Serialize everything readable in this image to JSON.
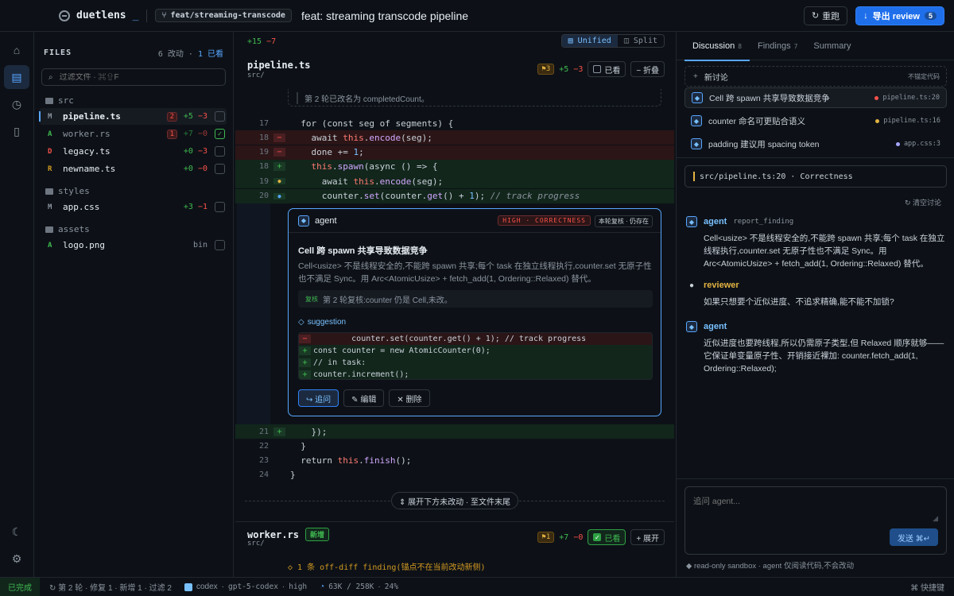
{
  "app": {
    "name": "duetlens",
    "cursor": "_"
  },
  "branch": "feat/streaming-transcode",
  "pr_title": "feat: streaming transcode pipeline",
  "actions": {
    "rerun": "重跑",
    "export": "导出 review",
    "export_count": "5"
  },
  "files": {
    "title": "FILES",
    "changes": "6 改动",
    "sep": "·",
    "seen": "1 已看",
    "filter_placeholder": "过滤文件 · ⌘⇧F",
    "groups": [
      {
        "folder": "src",
        "items": [
          {
            "status": "M",
            "name": "pipeline.ts",
            "badge": "2",
            "add": "+5",
            "del": "−3",
            "checked": false
          },
          {
            "status": "A",
            "name": "worker.rs",
            "badge": "1",
            "add": "+7",
            "del": "−0",
            "checked": true
          },
          {
            "status": "D",
            "name": "legacy.ts",
            "add": "+0",
            "del": "−3",
            "checked": false
          },
          {
            "status": "R",
            "name": "newname.ts",
            "add": "+0",
            "del": "−0",
            "checked": false
          }
        ]
      },
      {
        "folder": "styles",
        "items": [
          {
            "status": "M",
            "name": "app.css",
            "add": "+3",
            "del": "−1",
            "checked": false
          }
        ]
      },
      {
        "folder": "assets",
        "items": [
          {
            "status": "A",
            "name": "logo.png",
            "bin": "bin",
            "checked": false
          }
        ]
      }
    ]
  },
  "diff": {
    "summary_add": "+15",
    "summary_del": "−7",
    "view_unified": "Unified",
    "view_split": "Split",
    "file1": {
      "name": "pipeline.ts",
      "dir": "src/",
      "flags": "⚑3",
      "add": "+5",
      "del": "−3",
      "seen_label": "已看",
      "collapse_label": "− 折叠"
    },
    "prev_note": "第 2 轮已改名为 completedCount。",
    "lines_top": [
      {
        "ln": "17",
        "mk": "",
        "type": "ctx",
        "code": "  for (const seg of segments) {"
      },
      {
        "ln": "18",
        "mk": "−",
        "type": "del",
        "code": "    await this.encode(seg);"
      },
      {
        "ln": "19",
        "mk": "−",
        "type": "del",
        "code": "    done += 1;"
      },
      {
        "ln": "18",
        "mk": "+",
        "type": "add",
        "code": "    this.spawn(async () => {"
      },
      {
        "ln": "19",
        "mk": "●",
        "type": "add",
        "code": "      await this.encode(seg);"
      },
      {
        "ln": "20",
        "mk": "●",
        "type": "add",
        "code": "      counter.set(counter.get() + 1); // track progress"
      }
    ],
    "lines_bottom": [
      {
        "ln": "21",
        "mk": "+",
        "type": "add",
        "code": "    });"
      },
      {
        "ln": "22",
        "mk": "",
        "type": "ctx",
        "code": "  }"
      },
      {
        "ln": "23",
        "mk": "",
        "type": "ctx",
        "code": "  return this.finish();"
      },
      {
        "ln": "24",
        "mk": "",
        "type": "ctx",
        "code": "}"
      }
    ],
    "card": {
      "author": "agent",
      "severity": "HIGH · CORRECTNESS",
      "recheck": "本轮复核 · 仍存在",
      "title": "Cell 跨 spawn 共享导致数据竞争",
      "body": "Cell<usize> 不是线程安全的,不能跨 spawn 共享;每个 task 在独立线程执行,counter.set 无原子性也不满足 Sync。用 Arc<AtomicUsize> + fetch_add(1, Ordering::Relaxed) 替代。",
      "recheck_tag": "复核",
      "recheck_text": "第 2 轮复核:counter 仍是 Cell,未改。",
      "suggestion_label": "suggestion",
      "suggestion": [
        {
          "type": "d",
          "m": "−",
          "t": "        counter.set(counter.get() + 1); // track progress"
        },
        {
          "type": "a",
          "m": "+",
          "t": "const counter = new AtomicCounter(0);"
        },
        {
          "type": "a",
          "m": "+",
          "t": "// in task:"
        },
        {
          "type": "a",
          "m": "+",
          "t": "counter.increment();"
        }
      ],
      "btn_reply": "↪ 追问",
      "btn_edit": "✎ 编辑",
      "btn_delete": "✕ 删除"
    },
    "expand_label": "⇕ 展开下方未改动 · 至文件末尾",
    "file2": {
      "name": "worker.rs",
      "dir": "src/",
      "new_tag": "新增",
      "flags": "⚑1",
      "add": "+7",
      "del": "−0",
      "seen_label": "已看",
      "expand_label": "+ 展开"
    },
    "offdiff": "◇ 1 条 off-diff finding(锚点不在当前改动新侧)"
  },
  "right": {
    "tabs": [
      {
        "label": "Discussion",
        "n": "8"
      },
      {
        "label": "Findings",
        "n": "7"
      },
      {
        "label": "Summary",
        "n": ""
      }
    ],
    "new_thread": "新讨论",
    "new_thread_hint": "不锚定代码",
    "threads": [
      {
        "title": "Cell 跨 spawn 共享导致数据竞争",
        "loc": "pipeline.ts:20",
        "color": "#f85149"
      },
      {
        "title": "counter 命名可更贴合语义",
        "loc": "pipeline.ts:16",
        "color": "#e3b341"
      },
      {
        "title": "padding 建议用 spacing token",
        "loc": "app.css:3",
        "color": "#a5a5ff"
      }
    ],
    "location": "src/pipeline.ts:20 · Correctness",
    "clear": "↻ 清空讨论",
    "messages": [
      {
        "author": "agent",
        "kind": "report_finding",
        "text": "Cell<usize> 不是线程安全的,不能跨 spawn 共享;每个 task 在独立线程执行,counter.set 无原子性也不满足 Sync。用 Arc<AtomicUsize> + fetch_add(1, Ordering::Relaxed) 替代。"
      },
      {
        "author": "reviewer",
        "kind": "",
        "text": "如果只想要个近似进度、不追求精确,能不能不加锁?"
      },
      {
        "author": "agent",
        "kind": "",
        "text": "近似进度也要跨线程,所以仍需原子类型,但 Relaxed 顺序就够——它保证单变量原子性、开销接近裸加: counter.fetch_add(1, Ordering::Relaxed);"
      }
    ],
    "composer_placeholder": "追问 agent...",
    "send": "发送 ⌘↵",
    "sandbox": "◆ read-only sandbox · agent 仅阅读代码,不会改动"
  },
  "status": {
    "done": "已完成",
    "round": "↻ 第 2 轮 · 修复 1 · 新增 1 · 过滤 2",
    "engine": "codex",
    "model": "gpt-5-codex",
    "effort": "high",
    "tokens": "63K / 258K",
    "pct": "24%",
    "shortcuts": "⌘ 快捷键"
  }
}
